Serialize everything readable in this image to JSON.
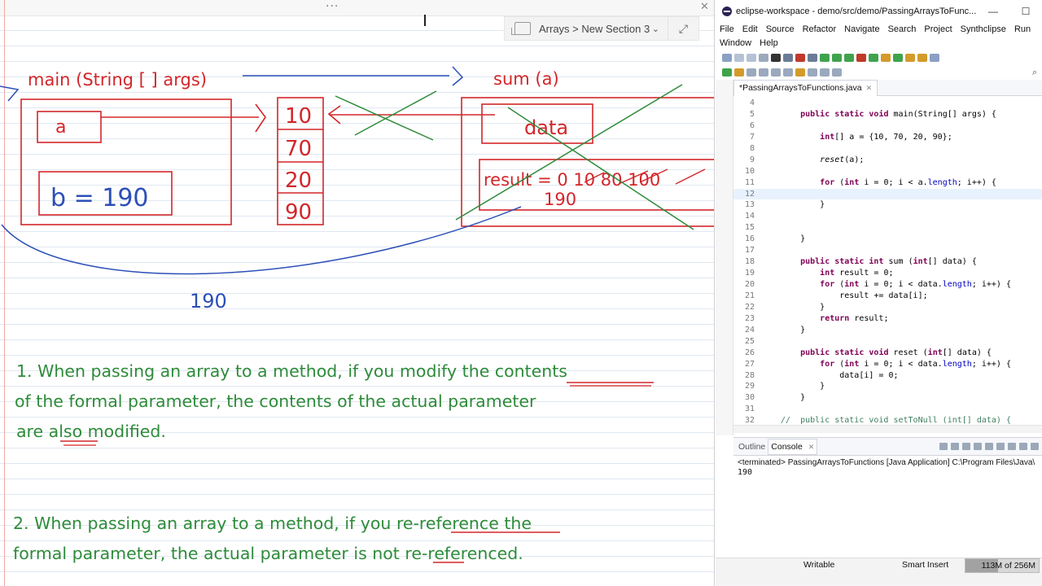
{
  "notebook": {
    "section_label": "Arrays > New Section 3",
    "handwritten": {
      "main_header": "main (String [ ] args)",
      "sum_header": "sum (a)",
      "var_a": "a",
      "var_b": "b = 190",
      "array_values": [
        "10",
        "70",
        "20",
        "90"
      ],
      "param_data": "data",
      "result_line": "result = 0 10 80 100",
      "result_value": "190",
      "return_value": "190",
      "note1_line1": "1. When passing an array to a method, if you modify the contents",
      "note1_line2": "of the formal parameter, the contents of the actual parameter",
      "note1_line3": "are also modified.",
      "note2_line1": "2. When passing an array to a method, if you re-reference the",
      "note2_line2": "formal parameter, the actual parameter is not re-referenced."
    }
  },
  "eclipse": {
    "title": "eclipse-workspace - demo/src/demo/PassingArraysToFunc...",
    "menu": [
      "File",
      "Edit",
      "Source",
      "Refactor",
      "Navigate",
      "Search",
      "Project",
      "Synthclipse",
      "Run",
      "Window",
      "Help"
    ],
    "editor_tab": "*PassingArraysToFunctions.java",
    "code_lines": [
      {
        "n": "4",
        "t": ""
      },
      {
        "n": "5",
        "t": "    public static void main(String[] args) {"
      },
      {
        "n": "6",
        "t": ""
      },
      {
        "n": "7",
        "t": "        int[] a = {10, 70, 20, 90};"
      },
      {
        "n": "8",
        "t": ""
      },
      {
        "n": "9",
        "t": "        reset(a);"
      },
      {
        "n": "10",
        "t": ""
      },
      {
        "n": "11",
        "t": "        for (int i = 0; i < a.length; i++) {"
      },
      {
        "n": "12",
        "t": "            "
      },
      {
        "n": "13",
        "t": "        }"
      },
      {
        "n": "14",
        "t": ""
      },
      {
        "n": "15",
        "t": ""
      },
      {
        "n": "16",
        "t": "    }"
      },
      {
        "n": "17",
        "t": ""
      },
      {
        "n": "18",
        "t": "    public static int sum (int[] data) {"
      },
      {
        "n": "19",
        "t": "        int result = 0;"
      },
      {
        "n": "20",
        "t": "        for (int i = 0; i < data.length; i++) {"
      },
      {
        "n": "21",
        "t": "            result += data[i];"
      },
      {
        "n": "22",
        "t": "        }"
      },
      {
        "n": "23",
        "t": "        return result;"
      },
      {
        "n": "24",
        "t": "    }"
      },
      {
        "n": "25",
        "t": ""
      },
      {
        "n": "26",
        "t": "    public static void reset (int[] data) {"
      },
      {
        "n": "27",
        "t": "        for (int i = 0; i < data.length; i++) {"
      },
      {
        "n": "28",
        "t": "            data[i] = 0;"
      },
      {
        "n": "29",
        "t": "        }"
      },
      {
        "n": "30",
        "t": "    }"
      },
      {
        "n": "31",
        "t": ""
      },
      {
        "n": "32",
        "t": "//  public static void setToNull (int[] data) {"
      }
    ],
    "outline_tab": "Outline",
    "console_tab": "Console",
    "console_status": "<terminated> PassingArraysToFunctions [Java Application] C:\\Program Files\\Java\\",
    "console_output": "190",
    "status": {
      "writable": "Writable",
      "insert_mode": "Smart Insert",
      "heap": "113M of 256M",
      "heap_fraction": 0.44
    }
  }
}
